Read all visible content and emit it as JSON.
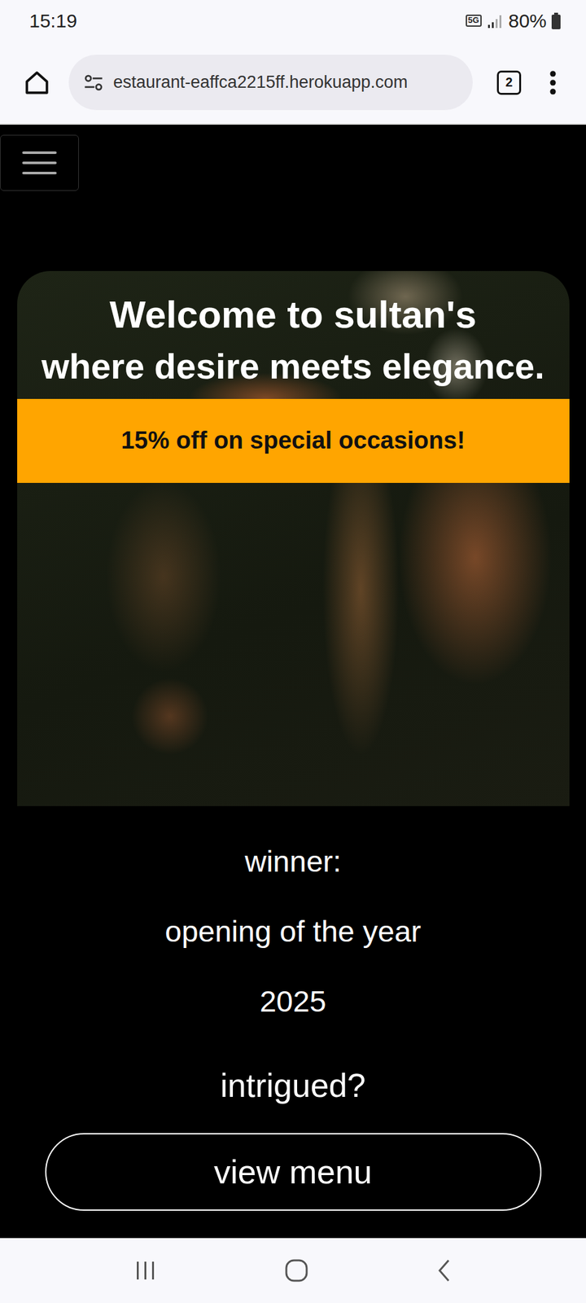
{
  "status_bar": {
    "time": "15:19",
    "network": "5G",
    "battery": "80%"
  },
  "browser": {
    "url": "estaurant-eaffca2215ff.herokuapp.com",
    "tab_count": "2"
  },
  "hero": {
    "title": "Welcome to sultan's",
    "subtitle": "where desire meets elegance.",
    "banner": "15% off on special occasions!"
  },
  "award": [
    "winner:",
    "opening of the year",
    "2025"
  ],
  "prompt": "intrigued?",
  "cta": "view menu"
}
